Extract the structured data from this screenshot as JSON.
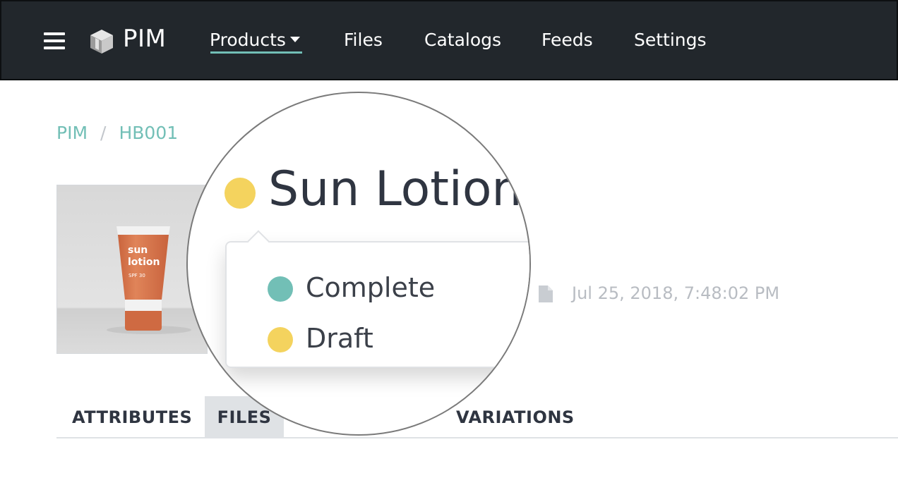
{
  "app": {
    "name": "PIM",
    "logo_icon": "cube-logo-icon",
    "menu_icon": "hamburger-menu-icon"
  },
  "nav": {
    "items": [
      {
        "label": "Products",
        "active": true
      },
      {
        "label": "Files"
      },
      {
        "label": "Catalogs"
      },
      {
        "label": "Feeds"
      },
      {
        "label": "Settings"
      }
    ]
  },
  "breadcrumb": {
    "items": [
      "PIM",
      "HB001"
    ],
    "separator": "/"
  },
  "product": {
    "title": "Sun Lotion",
    "status": "Draft",
    "image": {
      "brand_line1": "sun",
      "brand_line2": "lotion",
      "spf": "SPF 30"
    },
    "modified": "Jul 25, 2018, 7:48:02 PM"
  },
  "status_menu": {
    "options": [
      {
        "label": "Complete",
        "color": "#72bfb6"
      },
      {
        "label": "Draft",
        "color": "#f4d35e"
      }
    ]
  },
  "tabs": [
    {
      "label": "ATTRIBUTES"
    },
    {
      "label": "FILES",
      "active": true
    },
    {
      "label": "VARIATIONS"
    }
  ],
  "colors": {
    "accent": "#72bfb6",
    "draft": "#f4d35e",
    "navbar_bg": "#22272c",
    "product_orange": "#d9774f"
  }
}
